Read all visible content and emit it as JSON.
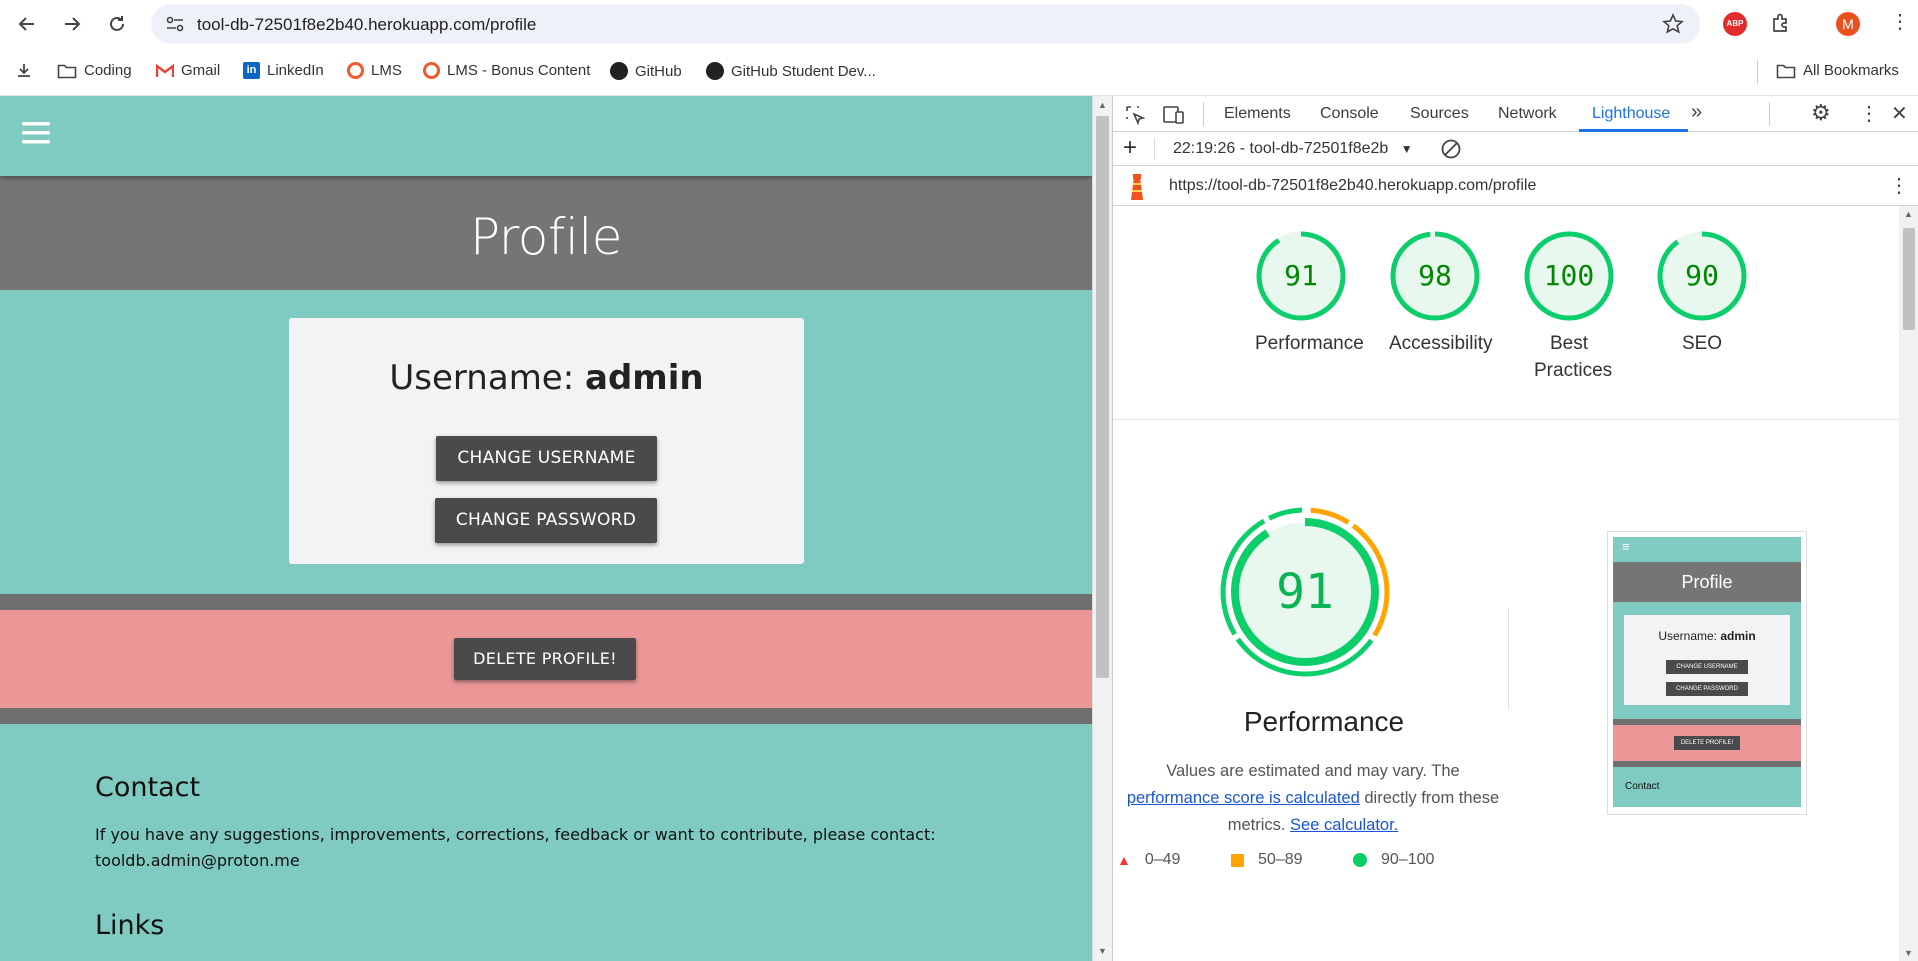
{
  "browser": {
    "url": "tool-db-72501f8e2b40.herokuapp.com/profile",
    "profile_initial": "M",
    "extension_abp": "ABP",
    "bookmarks": [
      "Coding",
      "Gmail",
      "LinkedIn",
      "LMS",
      "LMS - Bonus Content",
      "GitHub",
      "GitHub Student Dev..."
    ],
    "all_bookmarks": "All Bookmarks"
  },
  "page": {
    "title": "Profile",
    "username_label": "Username:",
    "username_value": "admin",
    "change_username": "CHANGE USERNAME",
    "change_password": "CHANGE PASSWORD",
    "delete_profile": "DELETE PROFILE!",
    "contact_heading": "Contact",
    "contact_text": "If you have any suggestions, improvements, corrections, feedback or want to contribute, please contact: tooldb.admin@proton.me",
    "links_heading": "Links"
  },
  "devtools": {
    "tabs": [
      "Elements",
      "Console",
      "Sources",
      "Network",
      "Lighthouse"
    ],
    "active_tab": "Lighthouse",
    "report_selector": "22:19:26 - tool-db-72501f8e2b",
    "report_url": "https://tool-db-72501f8e2b40.herokuapp.com/profile",
    "scores": [
      {
        "label": "Performance",
        "value": "91"
      },
      {
        "label": "Accessibility",
        "value": "98"
      },
      {
        "label": "Best Practices",
        "value": "100"
      },
      {
        "label": "SEO",
        "value": "90"
      }
    ],
    "big_score": "91",
    "perf_title": "Performance",
    "desc_1": "Values are estimated and may vary. The",
    "desc_link1": "performance score is calculated",
    "desc_2": "directly from these metrics.",
    "desc_link2": "See calculator.",
    "legend": [
      "0–49",
      "50–89",
      "90–100"
    ],
    "colors": {
      "pass": "#0cce6b",
      "average": "#ffa400",
      "fail": "#ff3333",
      "accent": "#1a73e8"
    },
    "thumbnail": {
      "title": "Profile",
      "username_label": "Username:",
      "username_value": "admin",
      "btn1": "CHANGE USERNAME",
      "btn2": "CHANGE PASSWORD",
      "btn3": "DELETE PROFILE!",
      "contact": "Contact"
    }
  }
}
